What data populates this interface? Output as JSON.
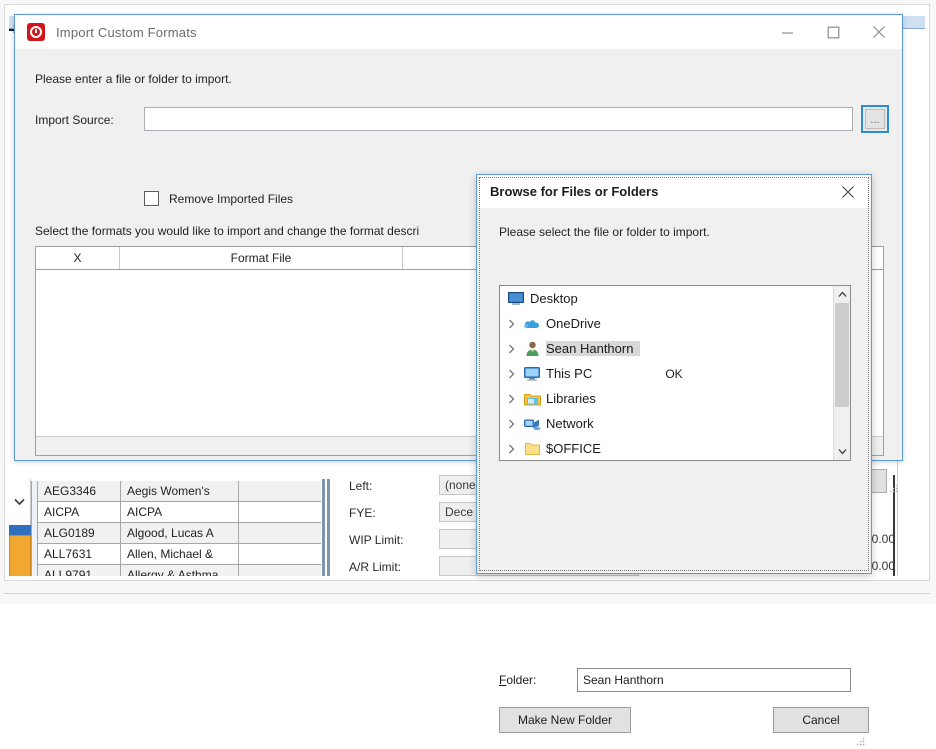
{
  "import_dialog": {
    "title": "Import Custom Formats",
    "icon": "app-clock-icon",
    "window_buttons": {
      "minimize": "minimize-icon",
      "maximize": "maximize-icon",
      "close": "close-icon"
    },
    "hint": "Please enter a file or folder to import.",
    "source_label": "Import Source:",
    "source_value": "",
    "source_placeholder": "",
    "browse_button": "...",
    "remove_checkbox_label": "Remove Imported Files",
    "remove_checkbox_checked": false,
    "select_line": "Select the formats you would like to import and change the format descri",
    "table": {
      "columns": [
        "X",
        "Format File",
        "",
        ""
      ],
      "rows": []
    },
    "ok_button": ""
  },
  "browse_dialog": {
    "title": "Browse for Files or Folders",
    "close_icon": "close-icon",
    "prompt": "Please select the file or folder to import.",
    "tree": [
      {
        "label": "Desktop",
        "icon": "desktop-icon",
        "expandable": false,
        "selected": false,
        "level": 0
      },
      {
        "label": "OneDrive",
        "icon": "onedrive-cloud-icon",
        "expandable": true,
        "selected": false,
        "level": 1
      },
      {
        "label": "Sean Hanthorn",
        "icon": "user-icon",
        "expandable": true,
        "selected": true,
        "level": 1
      },
      {
        "label": "This PC",
        "icon": "computer-icon",
        "expandable": true,
        "selected": false,
        "level": 1
      },
      {
        "label": "Libraries",
        "icon": "libraries-folder-icon",
        "expandable": true,
        "selected": false,
        "level": 1
      },
      {
        "label": "Network",
        "icon": "network-icon",
        "expandable": true,
        "selected": false,
        "level": 1
      },
      {
        "label": "$OFFICE",
        "icon": "folder-icon",
        "expandable": true,
        "selected": false,
        "level": 1
      },
      {
        "label": "",
        "icon": "folder-icon",
        "expandable": true,
        "selected": false,
        "level": 1
      }
    ],
    "scrollbar": {
      "up_icon": "chevron-up-icon",
      "down_icon": "chevron-down-icon"
    },
    "folder_label": "Folder:",
    "folder_value": "Sean Hanthorn",
    "buttons": {
      "make_new_folder": "Make New Folder",
      "ok": "OK",
      "cancel": "Cancel"
    }
  },
  "background": {
    "grid_rows": [
      {
        "id": "AEG3346",
        "name": "Aegis Women's"
      },
      {
        "id": "AICPA",
        "name": "AICPA"
      },
      {
        "id": "ALG0189",
        "name": "Algood, Lucas A"
      },
      {
        "id": "ALL7631",
        "name": "Allen, Michael &"
      },
      {
        "id": "ALL9791",
        "name": "Allergy & Asthma"
      }
    ],
    "fields": [
      {
        "label": "Left:",
        "value": "(none",
        "amount": ""
      },
      {
        "label": "FYE:",
        "value": "Dece",
        "amount": ""
      },
      {
        "label": "WIP Limit:",
        "value": "",
        "amount": "0.00"
      },
      {
        "label": "A/R Limit:",
        "value": "",
        "amount": "0.00"
      }
    ],
    "scroll_down_icon": "chevron-down-icon"
  },
  "colors": {
    "accent_blue": "#2f8ad8",
    "dialog_face": "#f0f0f0",
    "app_icon_red": "#d0161c",
    "tab_blue": "#1473c8",
    "band_orange": "#f0a830"
  }
}
